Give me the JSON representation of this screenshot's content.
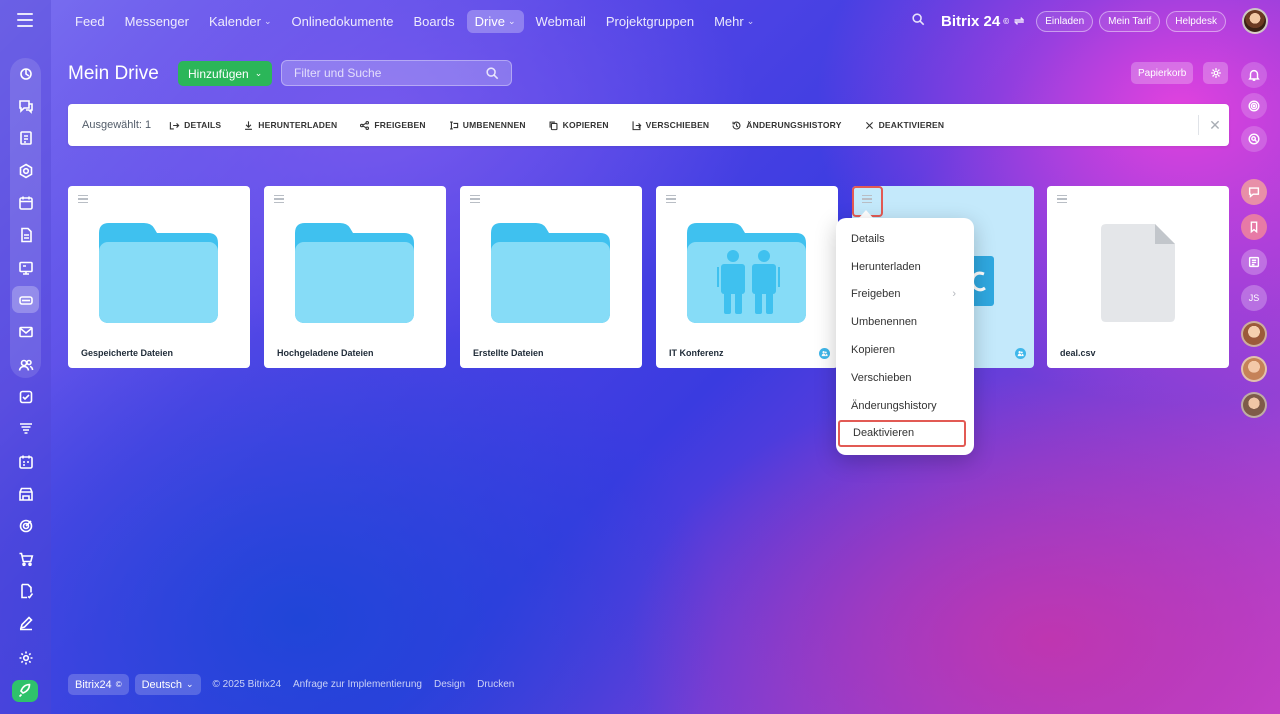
{
  "topnav": {
    "items": [
      {
        "label": "Feed",
        "dropdown": false,
        "active": false
      },
      {
        "label": "Messenger",
        "dropdown": false,
        "active": false
      },
      {
        "label": "Kalender",
        "dropdown": true,
        "active": false
      },
      {
        "label": "Onlinedokumente",
        "dropdown": false,
        "active": false
      },
      {
        "label": "Boards",
        "dropdown": false,
        "active": false
      },
      {
        "label": "Drive",
        "dropdown": true,
        "active": true
      },
      {
        "label": "Webmail",
        "dropdown": false,
        "active": false
      },
      {
        "label": "Projektgruppen",
        "dropdown": false,
        "active": false
      },
      {
        "label": "Mehr",
        "dropdown": true,
        "active": false
      }
    ],
    "logo": "Bitrix 24",
    "invite_label": "Einladen",
    "plan_label": "Mein Tarif",
    "helpdesk_label": "Helpdesk"
  },
  "page": {
    "title": "Mein Drive",
    "add_button": "Hinzufügen",
    "filter_placeholder": "Filter und Suche",
    "trash_label": "Papierkorb"
  },
  "action_bar": {
    "selected": "Ausgewählt: 1",
    "actions": [
      {
        "label": "DETAILS",
        "icon": "details-icon"
      },
      {
        "label": "HERUNTERLADEN",
        "icon": "download-icon"
      },
      {
        "label": "FREIGEBEN",
        "icon": "share-icon"
      },
      {
        "label": "UMBENENNEN",
        "icon": "rename-icon"
      },
      {
        "label": "KOPIEREN",
        "icon": "copy-icon"
      },
      {
        "label": "VERSCHIEBEN",
        "icon": "move-icon"
      },
      {
        "label": "ÄNDERUNGSHISTORY",
        "icon": "history-icon"
      },
      {
        "label": "DEAKTIVIEREN",
        "icon": "close-x-icon"
      }
    ]
  },
  "tiles": [
    {
      "name": "Gespeicherte Dateien",
      "type": "folder",
      "shared": false,
      "selected": false
    },
    {
      "name": "Hochgeladene Dateien",
      "type": "folder",
      "shared": false,
      "selected": false
    },
    {
      "name": "Erstellte Dateien",
      "type": "folder",
      "shared": false,
      "selected": false
    },
    {
      "name": "IT Konferenz",
      "type": "shared-folder",
      "shared": true,
      "selected": false
    },
    {
      "name": "",
      "type": "selected-file",
      "shared": true,
      "selected": true
    },
    {
      "name": "deal.csv",
      "type": "file",
      "shared": false,
      "selected": false
    }
  ],
  "context_menu": {
    "items": [
      {
        "label": "Details",
        "submenu": false,
        "highlight": false
      },
      {
        "label": "Herunterladen",
        "submenu": false,
        "highlight": false
      },
      {
        "label": "Freigeben",
        "submenu": true,
        "highlight": false
      },
      {
        "label": "Umbenennen",
        "submenu": false,
        "highlight": false
      },
      {
        "label": "Kopieren",
        "submenu": false,
        "highlight": false
      },
      {
        "label": "Verschieben",
        "submenu": false,
        "highlight": false
      },
      {
        "label": "Änderungshistory",
        "submenu": false,
        "highlight": false
      },
      {
        "label": "Deaktivieren",
        "submenu": false,
        "highlight": true
      }
    ]
  },
  "right_rail": {
    "user_initials": "JS"
  },
  "footer": {
    "brand": "Bitrix24",
    "language": "Deutsch",
    "copyright": "© 2025 Bitrix24",
    "links": [
      "Anfrage zur Implementierung",
      "Design",
      "Drucken"
    ]
  },
  "colors": {
    "accent_green": "#2bb659",
    "folder_light": "#86dcf7",
    "folder_dark": "#3fc1ef",
    "highlight_red": "#e25a54",
    "selected_tile": "#c4e9fb"
  }
}
